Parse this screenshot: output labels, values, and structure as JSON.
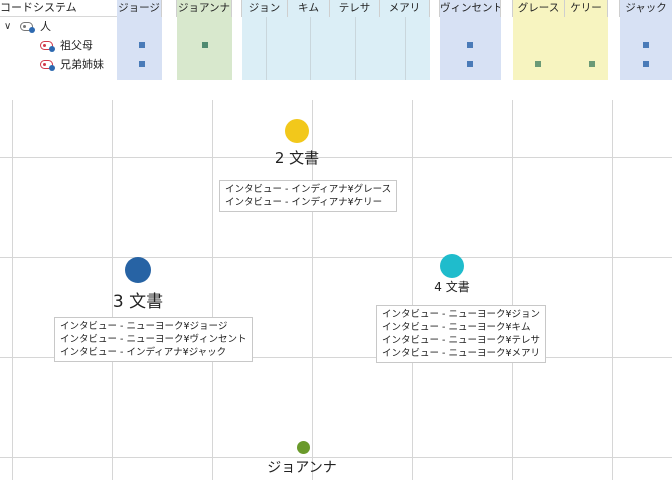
{
  "matrix": {
    "header_label": "コードシステム",
    "root": {
      "label": "人"
    },
    "rows": [
      {
        "label": "祖父母"
      },
      {
        "label": "兄弟姉妹"
      }
    ],
    "columns": {
      "george": "ジョージ",
      "joanna": "ジョアンナ",
      "john": "ジョン",
      "kim": "キム",
      "teresa": "テレサ",
      "mary": "メアリ",
      "vincent": "ヴィンセント",
      "grace": "グレース",
      "kelly": "ケリー",
      "jack": "ジャック"
    }
  },
  "map": {
    "nodes": {
      "two_docs": {
        "label": "2 文書",
        "color": "#f2c81b",
        "tips": [
          "インタビュー - インディアナ¥グレース",
          "インタビュー - インディアナ¥ケリー"
        ]
      },
      "three_docs": {
        "label": "3 文書",
        "color": "#2763a4",
        "tips": [
          "インタビュー - ニューヨーク¥ジョージ",
          "インタビュー - ニューヨーク¥ヴィンセント",
          "インタビュー - インディアナ¥ジャック"
        ]
      },
      "four_docs": {
        "label": "4 文書",
        "color": "#1fbccc",
        "tips": [
          "インタビュー - ニューヨーク¥ジョン",
          "インタビュー - ニューヨーク¥キム",
          "インタビュー - ニューヨーク¥テレサ",
          "インタビュー - ニューヨーク¥メアリ"
        ]
      },
      "joanna": {
        "label": "ジョアンナ",
        "color": "#6a9a2b"
      }
    }
  }
}
